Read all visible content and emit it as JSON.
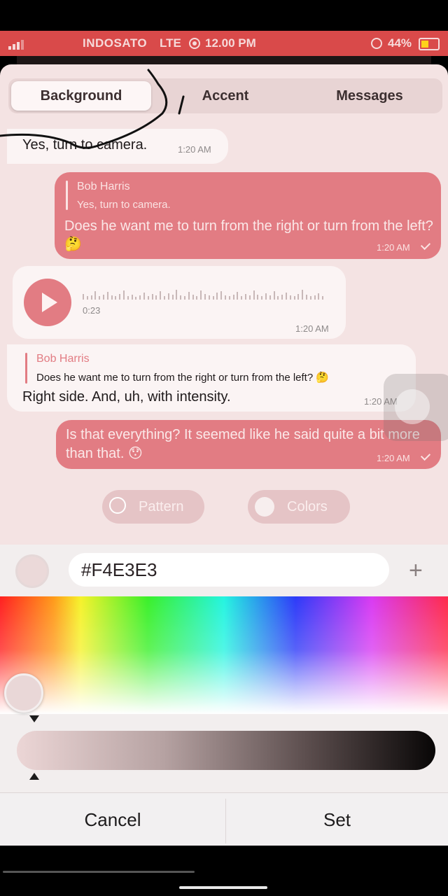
{
  "status_bar": {
    "carrier": "INDOSATO",
    "network": "LTE",
    "time": "12.00 PM",
    "battery": "44%",
    "battery_level": 0.44,
    "color": "#d94a4a"
  },
  "tabs": [
    {
      "label": "Background",
      "active": true
    },
    {
      "label": "Accent",
      "active": false
    },
    {
      "label": "Messages",
      "active": false
    }
  ],
  "messages": [
    {
      "id": "m1",
      "direction": "incoming",
      "text": "Yes, turn to camera.",
      "time": "1:20 AM"
    },
    {
      "id": "m2",
      "direction": "outgoing",
      "reply_name": "Bob Harris",
      "reply_text": "Yes, turn to camera.",
      "text": "Does he want me to turn from the right or turn from the left? 🤔",
      "time": "1:20 AM"
    },
    {
      "id": "m3",
      "direction": "incoming",
      "type": "voice",
      "duration": "0:23",
      "time": "1:20 AM"
    },
    {
      "id": "m4",
      "direction": "incoming",
      "reply_name": "Bob Harris",
      "reply_text": "Does he want me to turn from the right or turn from the left? 🤔",
      "text": "Right side. And, uh, with intensity.",
      "time": "1:20 AM"
    },
    {
      "id": "m5",
      "direction": "outgoing",
      "text": "Is that everything? It seemed like he said quite a bit more than that. 😯",
      "time": "1:20 AM"
    }
  ],
  "options": {
    "pattern_label": "Pattern",
    "colors_label": "Colors"
  },
  "color_editor": {
    "hex_value": "#F4E3E3",
    "swatch_color": "#F4E3E3"
  },
  "buttons": {
    "cancel": "Cancel",
    "set": "Set"
  },
  "colors": {
    "accent": "#e27c83",
    "background": "#f4e3e3"
  }
}
